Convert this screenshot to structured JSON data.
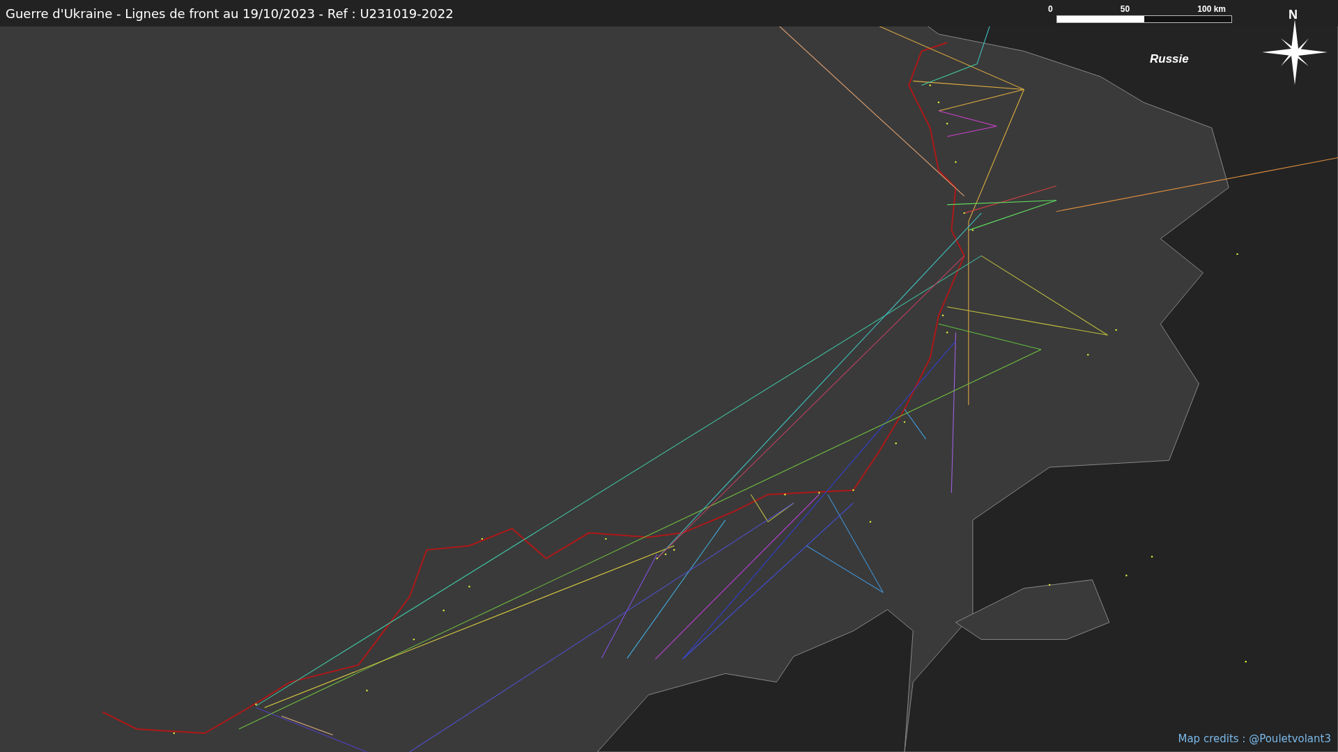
{
  "title": "Guerre d'Ukraine - Lignes de front au 19/10/2023 - Ref : U231019-2022",
  "scale_bar": {
    "labels": [
      "0",
      "50",
      "100 km"
    ]
  },
  "compass": {
    "label": "N"
  },
  "map_labels": [
    "Russie"
  ],
  "credits": "Map credits : @Pouletvolant3"
}
